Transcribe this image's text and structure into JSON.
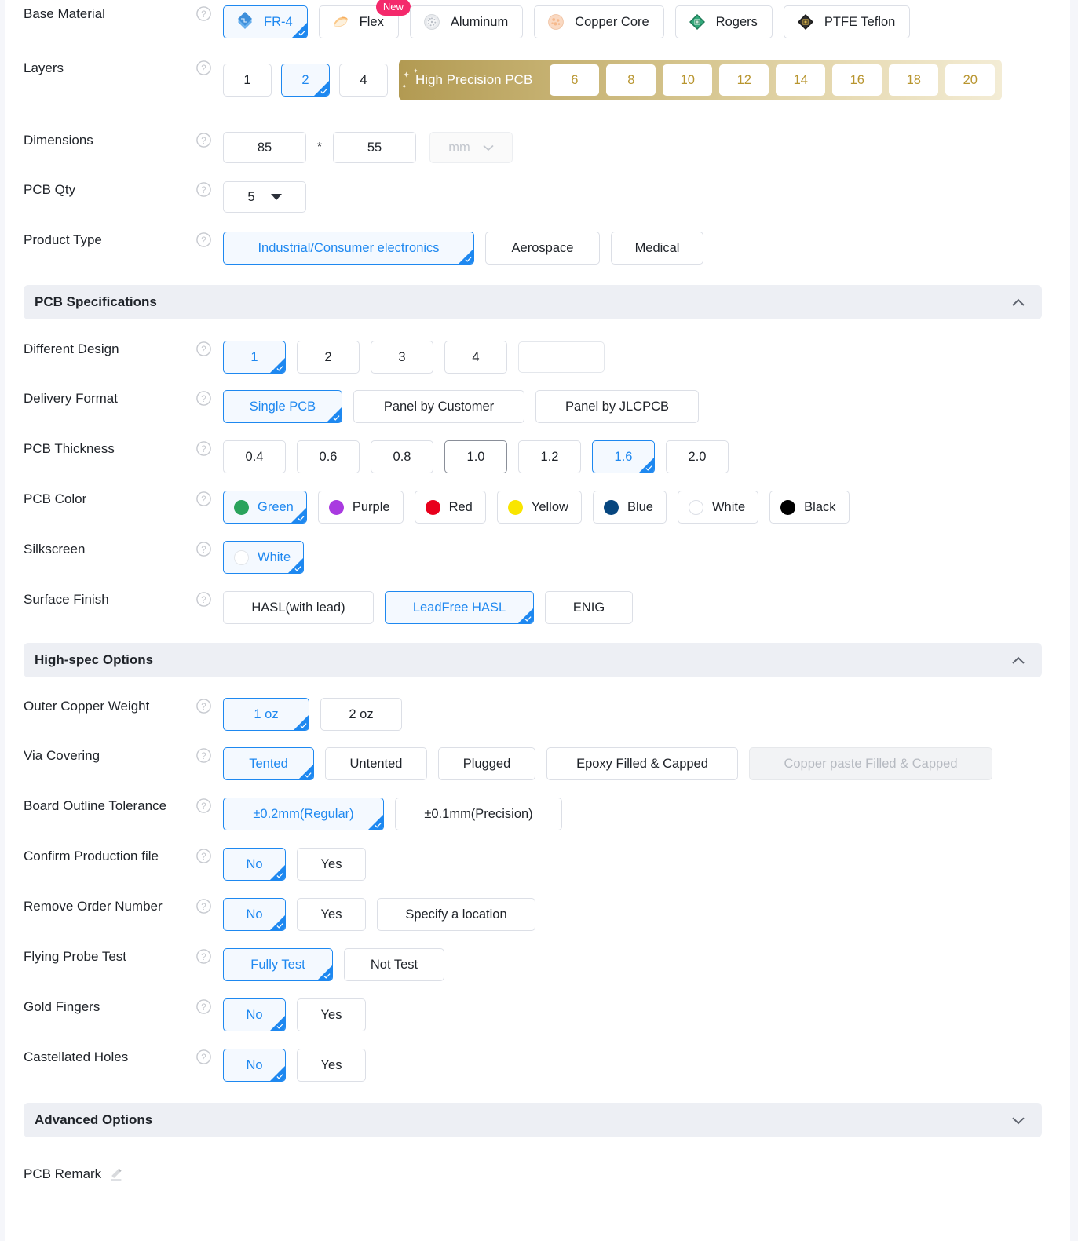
{
  "rows": {
    "base_material": {
      "label": "Base Material",
      "options": [
        {
          "label": "FR-4",
          "icon": "fr4-icon",
          "selected": true
        },
        {
          "label": "Flex",
          "icon": "flex-icon",
          "selected": false,
          "badge": "New"
        },
        {
          "label": "Aluminum",
          "icon": "aluminum-icon",
          "selected": false
        },
        {
          "label": "Copper Core",
          "icon": "copper-core-icon",
          "selected": false
        },
        {
          "label": "Rogers",
          "icon": "rogers-icon",
          "selected": false
        },
        {
          "label": "PTFE Teflon",
          "icon": "ptfe-teflon-icon",
          "selected": false
        }
      ]
    },
    "layers": {
      "label": "Layers",
      "options": [
        {
          "label": "1",
          "selected": false
        },
        {
          "label": "2",
          "selected": true
        },
        {
          "label": "4",
          "selected": false
        }
      ],
      "high_precision": {
        "label": "High Precision PCB",
        "options": [
          "6",
          "8",
          "10",
          "12",
          "14",
          "16",
          "18",
          "20"
        ]
      }
    },
    "dimensions": {
      "label": "Dimensions",
      "width_value": "85",
      "separator": "*",
      "height_value": "55",
      "unit": "mm"
    },
    "pcb_qty": {
      "label": "PCB Qty",
      "value": "5"
    },
    "product_type": {
      "label": "Product Type",
      "options": [
        {
          "label": "Industrial/Consumer electronics",
          "selected": true
        },
        {
          "label": "Aerospace",
          "selected": false
        },
        {
          "label": "Medical",
          "selected": false
        }
      ]
    },
    "different_design": {
      "label": "Different Design",
      "options": [
        {
          "label": "1",
          "selected": true
        },
        {
          "label": "2",
          "selected": false
        },
        {
          "label": "3",
          "selected": false
        },
        {
          "label": "4",
          "selected": false
        }
      ],
      "custom_value": ""
    },
    "delivery_format": {
      "label": "Delivery Format",
      "options": [
        {
          "label": "Single PCB",
          "selected": true
        },
        {
          "label": "Panel by Customer",
          "selected": false
        },
        {
          "label": "Panel by JLCPCB",
          "selected": false
        }
      ]
    },
    "pcb_thickness": {
      "label": "PCB Thickness",
      "options": [
        {
          "label": "0.4",
          "selected": false
        },
        {
          "label": "0.6",
          "selected": false
        },
        {
          "label": "0.8",
          "selected": false
        },
        {
          "label": "1.0",
          "selected": false,
          "hover": true
        },
        {
          "label": "1.2",
          "selected": false
        },
        {
          "label": "1.6",
          "selected": true
        },
        {
          "label": "2.0",
          "selected": false
        }
      ]
    },
    "pcb_color": {
      "label": "PCB Color",
      "options": [
        {
          "label": "Green",
          "color": "#2aa35c",
          "selected": true
        },
        {
          "label": "Purple",
          "color": "#a93ae0",
          "selected": false
        },
        {
          "label": "Red",
          "color": "#e8001c",
          "selected": false
        },
        {
          "label": "Yellow",
          "color": "#f9e500",
          "selected": false
        },
        {
          "label": "Blue",
          "color": "#07467f",
          "selected": false
        },
        {
          "label": "White",
          "color": "#ffffff",
          "selected": false
        },
        {
          "label": "Black",
          "color": "#000000",
          "selected": false
        }
      ]
    },
    "silkscreen": {
      "label": "Silkscreen",
      "options": [
        {
          "label": "White",
          "color": "#ffffff",
          "selected": true
        }
      ]
    },
    "surface_finish": {
      "label": "Surface Finish",
      "options": [
        {
          "label": "HASL(with lead)",
          "selected": false
        },
        {
          "label": "LeadFree HASL",
          "selected": true
        },
        {
          "label": "ENIG",
          "selected": false
        }
      ]
    },
    "outer_copper_weight": {
      "label": "Outer Copper Weight",
      "options": [
        {
          "label": "1 oz",
          "selected": true
        },
        {
          "label": "2 oz",
          "selected": false
        }
      ]
    },
    "via_covering": {
      "label": "Via Covering",
      "options": [
        {
          "label": "Tented",
          "selected": true
        },
        {
          "label": "Untented",
          "selected": false
        },
        {
          "label": "Plugged",
          "selected": false
        },
        {
          "label": "Epoxy Filled & Capped",
          "selected": false
        },
        {
          "label": "Copper paste Filled & Capped",
          "selected": false,
          "disabled": true
        }
      ]
    },
    "board_outline_tolerance": {
      "label": "Board Outline Tolerance",
      "options": [
        {
          "label": "±0.2mm(Regular)",
          "selected": true
        },
        {
          "label": "±0.1mm(Precision)",
          "selected": false
        }
      ]
    },
    "confirm_production_file": {
      "label": "Confirm Production file",
      "options": [
        {
          "label": "No",
          "selected": true
        },
        {
          "label": "Yes",
          "selected": false
        }
      ]
    },
    "remove_order_number": {
      "label": "Remove Order Number",
      "options": [
        {
          "label": "No",
          "selected": true
        },
        {
          "label": "Yes",
          "selected": false
        },
        {
          "label": "Specify a location",
          "selected": false
        }
      ]
    },
    "flying_probe_test": {
      "label": "Flying Probe Test",
      "options": [
        {
          "label": "Fully Test",
          "selected": true
        },
        {
          "label": "Not Test",
          "selected": false
        }
      ]
    },
    "gold_fingers": {
      "label": "Gold Fingers",
      "options": [
        {
          "label": "No",
          "selected": true
        },
        {
          "label": "Yes",
          "selected": false
        }
      ]
    },
    "castellated_holes": {
      "label": "Castellated Holes",
      "options": [
        {
          "label": "No",
          "selected": true
        },
        {
          "label": "Yes",
          "selected": false
        }
      ]
    }
  },
  "sections": {
    "pcb_specifications": {
      "title": "PCB Specifications",
      "expanded": true,
      "chevron": "chevron-up-icon"
    },
    "high_spec_options": {
      "title": "High-spec Options",
      "expanded": true,
      "chevron": "chevron-up-icon"
    },
    "advanced_options": {
      "title": "Advanced Options",
      "expanded": false,
      "chevron": "chevron-down-icon"
    }
  },
  "pcb_remark": {
    "label": "PCB Remark",
    "edit_icon": "pencil-icon"
  },
  "colors": {
    "accent": "#1e88f0",
    "accent_bg": "#f4f9ff",
    "border": "#dcdfe6",
    "section_bg": "#edeff4",
    "badge": "#f4296b",
    "gold": "#b8952f"
  }
}
